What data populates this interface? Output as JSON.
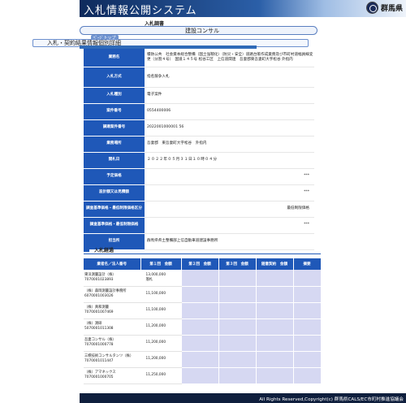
{
  "header": {
    "title": "入札情報公開システム",
    "pref_name": "群馬県",
    "emblem_icon": "gunma-emblem-icon"
  },
  "subheader": {
    "section_label": "入札調書",
    "type_value": "建設コンサル",
    "small_link": "ﾍﾟｰｼﾞトップ",
    "page_title": "入札・契約結果情報個別詳細"
  },
  "details": {
    "name": {
      "label": "業務名",
      "value": "積防公共　社会資本総合整備（国土強靱化）（防災・安全）道路台帳作成業務及び市町村道幅員線変更（分割４号）　国道１４５号 松谷工区　上信道関連　吾妻郡東吾妻町大字松谷 外指内"
    },
    "method": {
      "label": "入札方式",
      "value": "指名競争入札"
    },
    "format": {
      "label": "入札種別",
      "value": "電子案件"
    },
    "case_no": {
      "label": "案件番号",
      "value": "0554400006"
    },
    "procure_no": {
      "label": "調達案件番号",
      "value": "2022001000001 56"
    },
    "place": {
      "label": "業務場所",
      "value": "吾妻郡　東吾妻町大字松谷　外指内"
    },
    "open_date": {
      "label": "開札日",
      "value": "２０２２年０５月３１日１０時０４分"
    },
    "planned_price": {
      "label": "予定価格",
      "value": "***"
    },
    "low_limit": {
      "label": "設計額又は見積額",
      "value": "***"
    },
    "survey": {
      "label": "調査基準価格・最低制限価格区分",
      "sublabel": "最低制限価格",
      "value": ""
    },
    "survey_price": {
      "label": "調査基準価格・最低制限価格",
      "value": "***"
    },
    "office": {
      "label": "担当所",
      "value": "群馬県県土整備部上信自動車道建設事務所"
    }
  },
  "progress": {
    "title": "入札経過",
    "columns": [
      "業者名／法人番号",
      "第１回　金額",
      "第２回　金額",
      "第３回　金額",
      "随意契約　金額",
      "摘要"
    ],
    "rows": [
      {
        "name": "東洋測量設計（株）",
        "corp_no": "7070001023893",
        "amount": "13,000,000",
        "note": "落札",
        "winner": true
      },
      {
        "name": "（株）森岡測量設計事務所",
        "corp_no": "6070001003026",
        "amount": "11,100,000",
        "note": "",
        "winner": false
      },
      {
        "name": "（株）真和測量",
        "corp_no": "7070001007469",
        "amount": "11,100,000",
        "note": "",
        "winner": false
      },
      {
        "name": "（株）測研",
        "corp_no": "5070001011308",
        "amount": "11,200,000",
        "note": "",
        "winner": false
      },
      {
        "name": "吾妻コンサル（株）",
        "corp_no": "7070001000778",
        "amount": "11,200,000",
        "note": "",
        "winner": false
      },
      {
        "name": "三幌技術コンサルタンツ（株）",
        "corp_no": "7070001011447",
        "amount": "11,200,000",
        "note": "",
        "winner": false
      },
      {
        "name": "（株）アマネックス",
        "corp_no": "7070001000705",
        "amount": "11,250,000",
        "note": "",
        "winner": false
      }
    ]
  },
  "footer": {
    "copyright": "All Rights Reserved,Copyright(c) 群馬県CALS/EC市町村推進協議会"
  },
  "colors": {
    "header_dark": "#0e2a5c",
    "label_blue": "#1f58b8",
    "row_pad": "#d6d8f2",
    "winner_red": "#d00000"
  }
}
